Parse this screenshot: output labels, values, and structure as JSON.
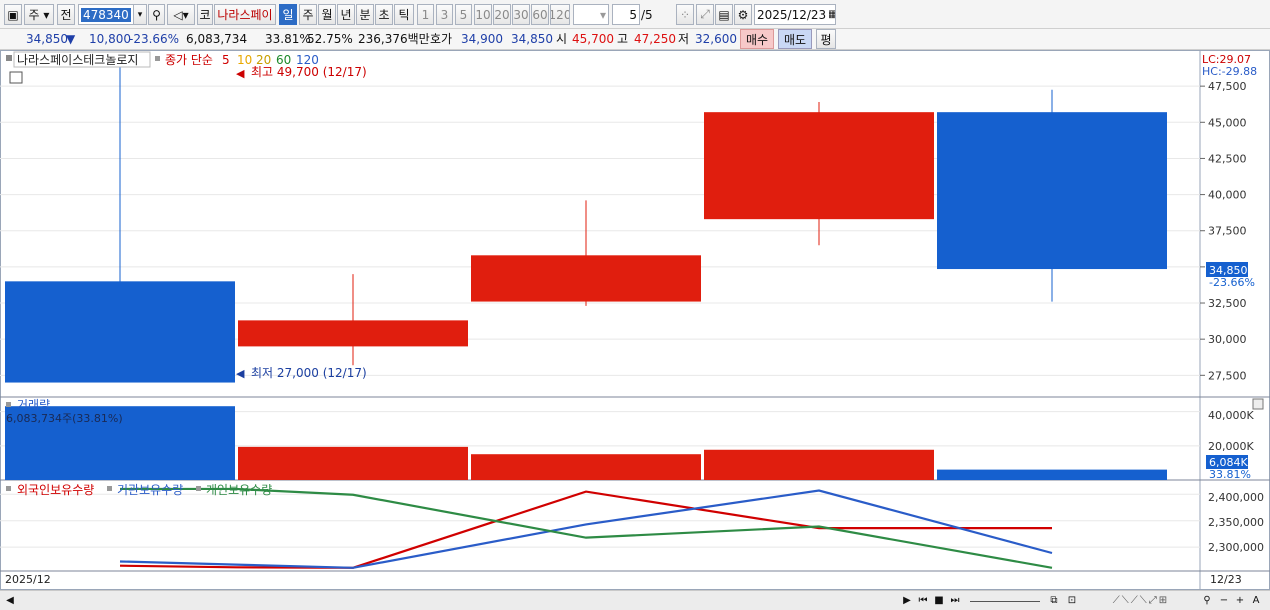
{
  "toolbar": {
    "period_label": "주",
    "prev_label": "전",
    "code_value": "478340",
    "kr_tag": "코",
    "stock_name": "나라스페이",
    "intervals": [
      "일",
      "주",
      "월",
      "년",
      "분",
      "초",
      "틱"
    ],
    "numbers": [
      "1",
      "3",
      "5",
      "10",
      "20",
      "30",
      "60",
      "120"
    ],
    "page_counter": "5",
    "page_total": "/5",
    "date_value": "2025/12/23"
  },
  "quote": {
    "price": "34,850",
    "change_dir": "▼",
    "change": "10,800",
    "change_pct": "-23.66%",
    "volume": "6,083,734",
    "volume_pct": "33.81%",
    "ratio": "52.75%",
    "amount": "236,376백만",
    "bid_label": "호가",
    "bid": "34,900",
    "ask": "34,850",
    "open_label": "시",
    "open": "45,700",
    "high_label": "고",
    "high": "47,250",
    "low_label": "저",
    "low": "32,600",
    "buy_label": "매수",
    "sell_label": "매도",
    "eval_label": "평"
  },
  "price_panel": {
    "title": "나라스페이스테크놀로지",
    "ma_label": "종가 단순",
    "ma_periods": [
      "5",
      "10",
      "20",
      "60",
      "120"
    ],
    "ma_colors": [
      "#d00000",
      "#e8a800",
      "#c8a000",
      "#1d8a2a",
      "#2a5cc8"
    ],
    "lc_label": "LC:29.07",
    "hc_label": "HC:-29.88",
    "max_label": "최고 49,700 (12/17)",
    "min_label": "최저 27,000 (12/17)",
    "last_price_tag": "34,850",
    "last_pct_tag": "-23.66%",
    "yticks": [
      27500,
      30000,
      32500,
      35000,
      37500,
      40000,
      42500,
      45000,
      47500
    ],
    "ytick_labels": [
      "27,500",
      "30,000",
      "32,500",
      "35,000",
      "37,500",
      "40,000",
      "42,500",
      "45,000",
      "47,500"
    ]
  },
  "volume_panel": {
    "title": "거래량",
    "current": "6,083,734주(33.81%)",
    "ytick_labels": [
      "20,000K",
      "40,000K"
    ],
    "last_tag": "6,084K",
    "last_pct": "33.81%"
  },
  "holdings_panel": {
    "legend": [
      "외국인보유수량",
      "기관보유수량",
      "개인보유수량"
    ],
    "legend_colors": [
      "#d00000",
      "#2a5cc8",
      "#2e8b45"
    ],
    "ytick_labels": [
      "2,300,000",
      "2,350,000",
      "2,400,000"
    ]
  },
  "x_axis": {
    "left_label": "2025/12",
    "right_label": "12/23"
  },
  "chart_data": [
    {
      "type": "candlestick",
      "title": "나라스페이스테크놀로지",
      "ylim": [
        26000,
        50000
      ],
      "candles": [
        {
          "open": 34000,
          "high": 49700,
          "low": 27000,
          "close": 27000,
          "color": "#1560cf"
        },
        {
          "open": 29500,
          "high": 34500,
          "low": 28200,
          "close": 31300,
          "color": "#e01e0e"
        },
        {
          "open": 32600,
          "high": 39600,
          "low": 32300,
          "close": 35800,
          "color": "#e01e0e"
        },
        {
          "open": 38300,
          "high": 46400,
          "low": 36500,
          "close": 45700,
          "color": "#e01e0e"
        },
        {
          "open": 45700,
          "high": 47250,
          "low": 32600,
          "close": 34850,
          "color": "#1560cf"
        }
      ]
    },
    {
      "type": "bar",
      "title": "거래량",
      "unit": "K",
      "ylim": [
        0,
        48000
      ],
      "values": [
        43200,
        19400,
        15100,
        17700,
        6084
      ],
      "colors": [
        "#1560cf",
        "#e01e0e",
        "#e01e0e",
        "#e01e0e",
        "#1560cf"
      ]
    },
    {
      "type": "line",
      "ylim": [
        2255000,
        2425000
      ],
      "series": [
        {
          "name": "외국인보유수량",
          "color": "#d00000",
          "values": [
            2265000,
            2262000,
            2261000,
            2405000,
            2336000,
            2336000
          ]
        },
        {
          "name": "기관보유수량",
          "color": "#2a5cc8",
          "values": [
            2273000,
            2267000,
            2261000,
            2343000,
            2407000,
            2289000
          ]
        },
        {
          "name": "개인보유수량",
          "color": "#2e8b45",
          "values": [
            2410000,
            2410000,
            2399000,
            2318000,
            2339000,
            2261000
          ]
        }
      ]
    }
  ],
  "status": {
    "nav_icons": [
      "play-next-icon",
      "first-page-icon",
      "stop-icon",
      "last-page-icon"
    ],
    "tool_icons": [
      "copy-icon",
      "zoom-icon",
      "zoom-out-icon",
      "zoom-in-icon",
      "text-icon"
    ]
  }
}
